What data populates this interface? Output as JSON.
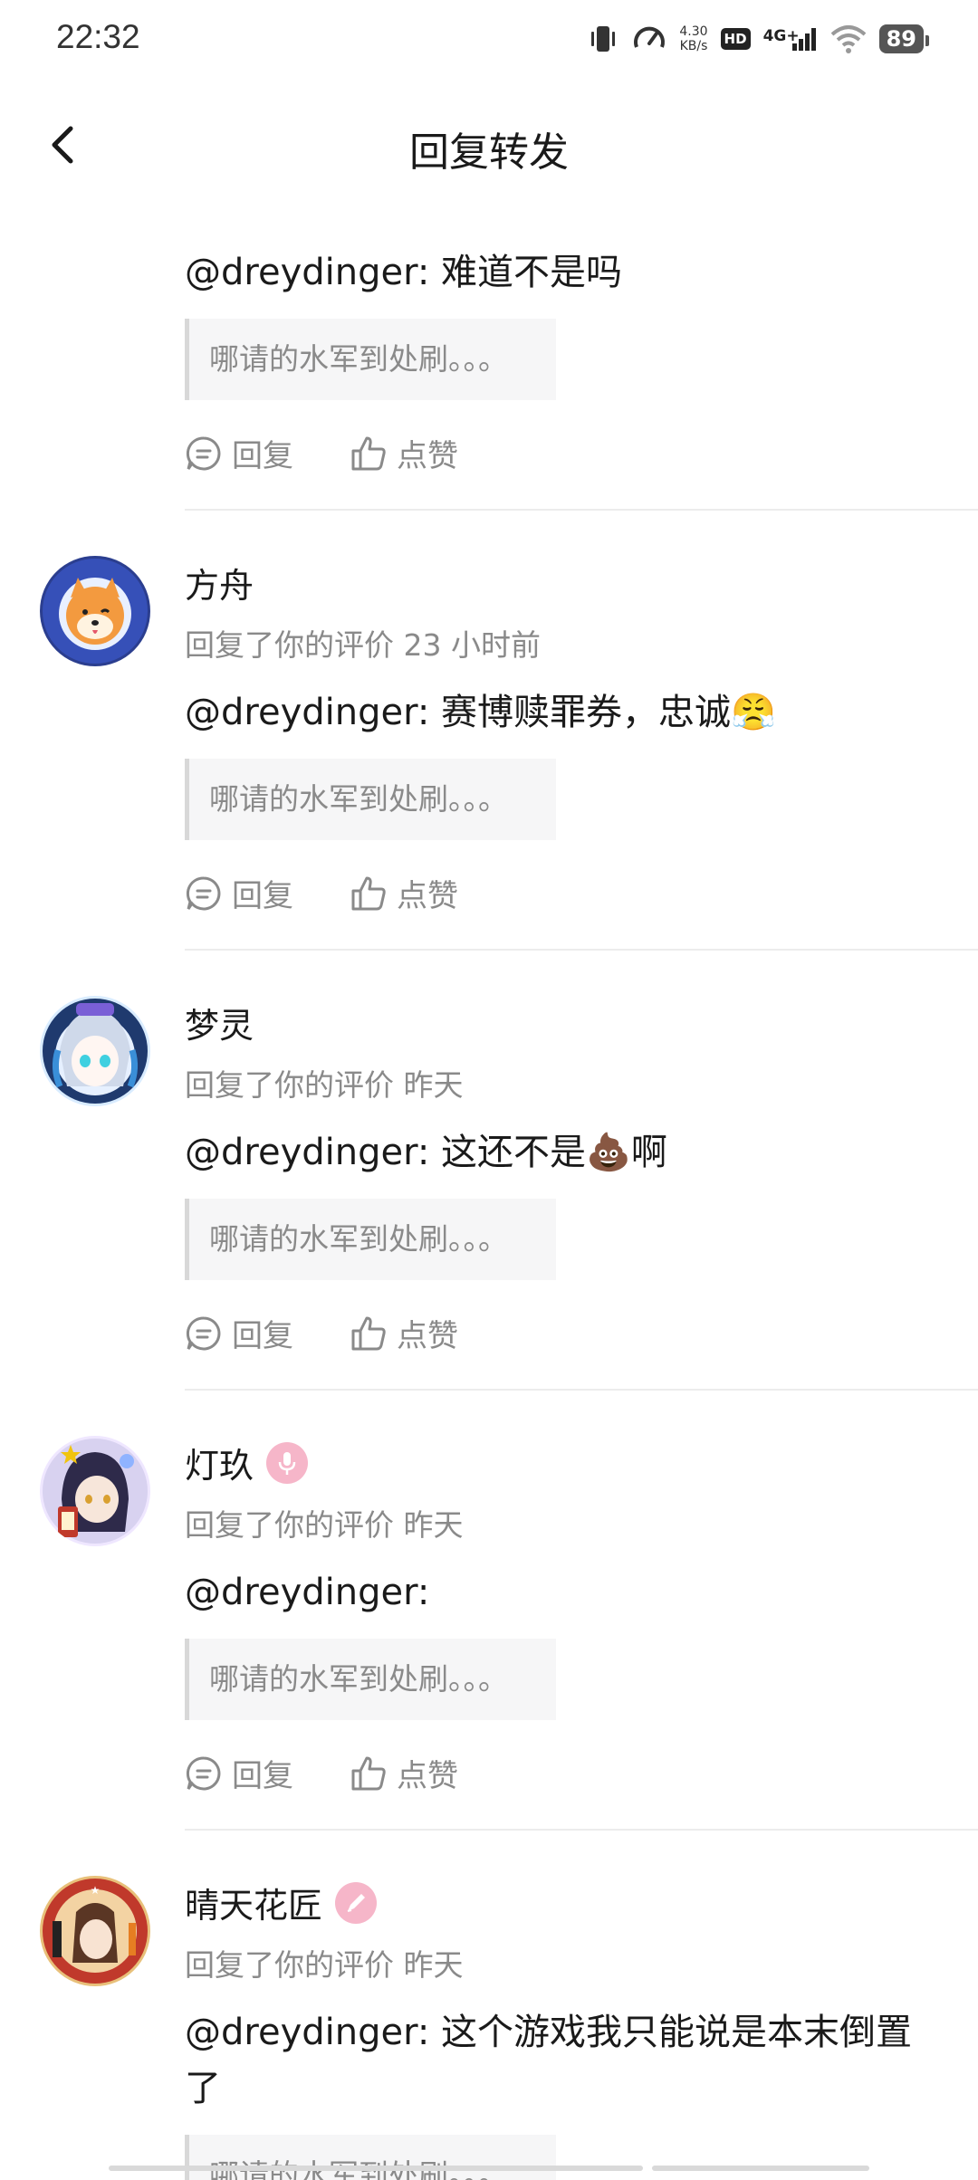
{
  "status_bar": {
    "time": "22:32",
    "net_speed_value": "4.30",
    "net_speed_unit": "KB/s",
    "hd_label": "HD",
    "network_label": "4G+",
    "battery": "89"
  },
  "header": {
    "title": "回复转发"
  },
  "actions": {
    "reply_label": "回复",
    "like_label": "点赞"
  },
  "replies": [
    {
      "message": "@dreydinger: 难道不是吗",
      "quote": "哪请的水军到处刷。。。"
    },
    {
      "name": "方舟",
      "meta": "回复了你的评价 23 小时前",
      "message": "@dreydinger: 赛博赎罪券，忠诚😤",
      "quote": "哪请的水军到处刷。。。"
    },
    {
      "name": "梦灵",
      "meta": "回复了你的评价 昨天",
      "message": "@dreydinger: 这还不是💩啊",
      "quote": "哪请的水军到处刷。。。"
    },
    {
      "name": "灯玖",
      "meta": "回复了你的评价 昨天",
      "message": "@dreydinger:",
      "quote": "哪请的水军到处刷。。。"
    },
    {
      "name": "晴天花匠",
      "meta": "回复了你的评价 昨天",
      "message": "@dreydinger: 这个游戏我只能说是本末倒置了",
      "quote": "哪请的水军到处刷。。。"
    }
  ]
}
